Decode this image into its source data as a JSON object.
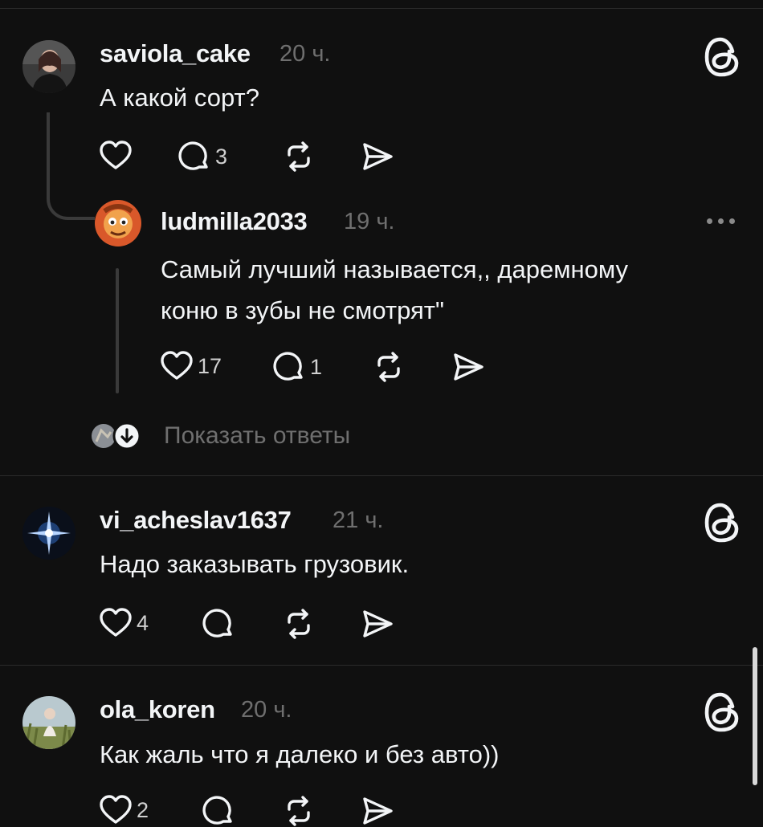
{
  "comments": [
    {
      "username": "saviola_cake",
      "time": "20 ч.",
      "text": "А какой сорт?",
      "reply_count": "3",
      "like_count": "",
      "reply": {
        "username": "ludmilla2033",
        "time": "19 ч.",
        "text_lines": [
          "Самый лучший называется,, даремному",
          "коню в зубы не смотрят\""
        ],
        "like_count": "17",
        "reply_count": "1"
      },
      "show_replies_label": "Показать ответы"
    },
    {
      "username": "vi_acheslav1637",
      "time": "21 ч.",
      "text": "Надо заказывать грузовик.",
      "like_count": "4",
      "reply_count": ""
    },
    {
      "username": "ola_koren",
      "time": "20 ч.",
      "text": "Как жаль что я далеко и без авто))",
      "like_count": "2",
      "reply_count": ""
    }
  ],
  "icons": {
    "like": "heart-icon",
    "reply": "comment-icon",
    "repost": "repost-icon",
    "share": "send-icon",
    "app": "threads-logo-icon",
    "more": "more-dots-icon"
  },
  "colors": {
    "background": "#101010",
    "text": "#f3f5f7",
    "muted": "#6f6f6f",
    "divider": "#2a2a2a"
  }
}
